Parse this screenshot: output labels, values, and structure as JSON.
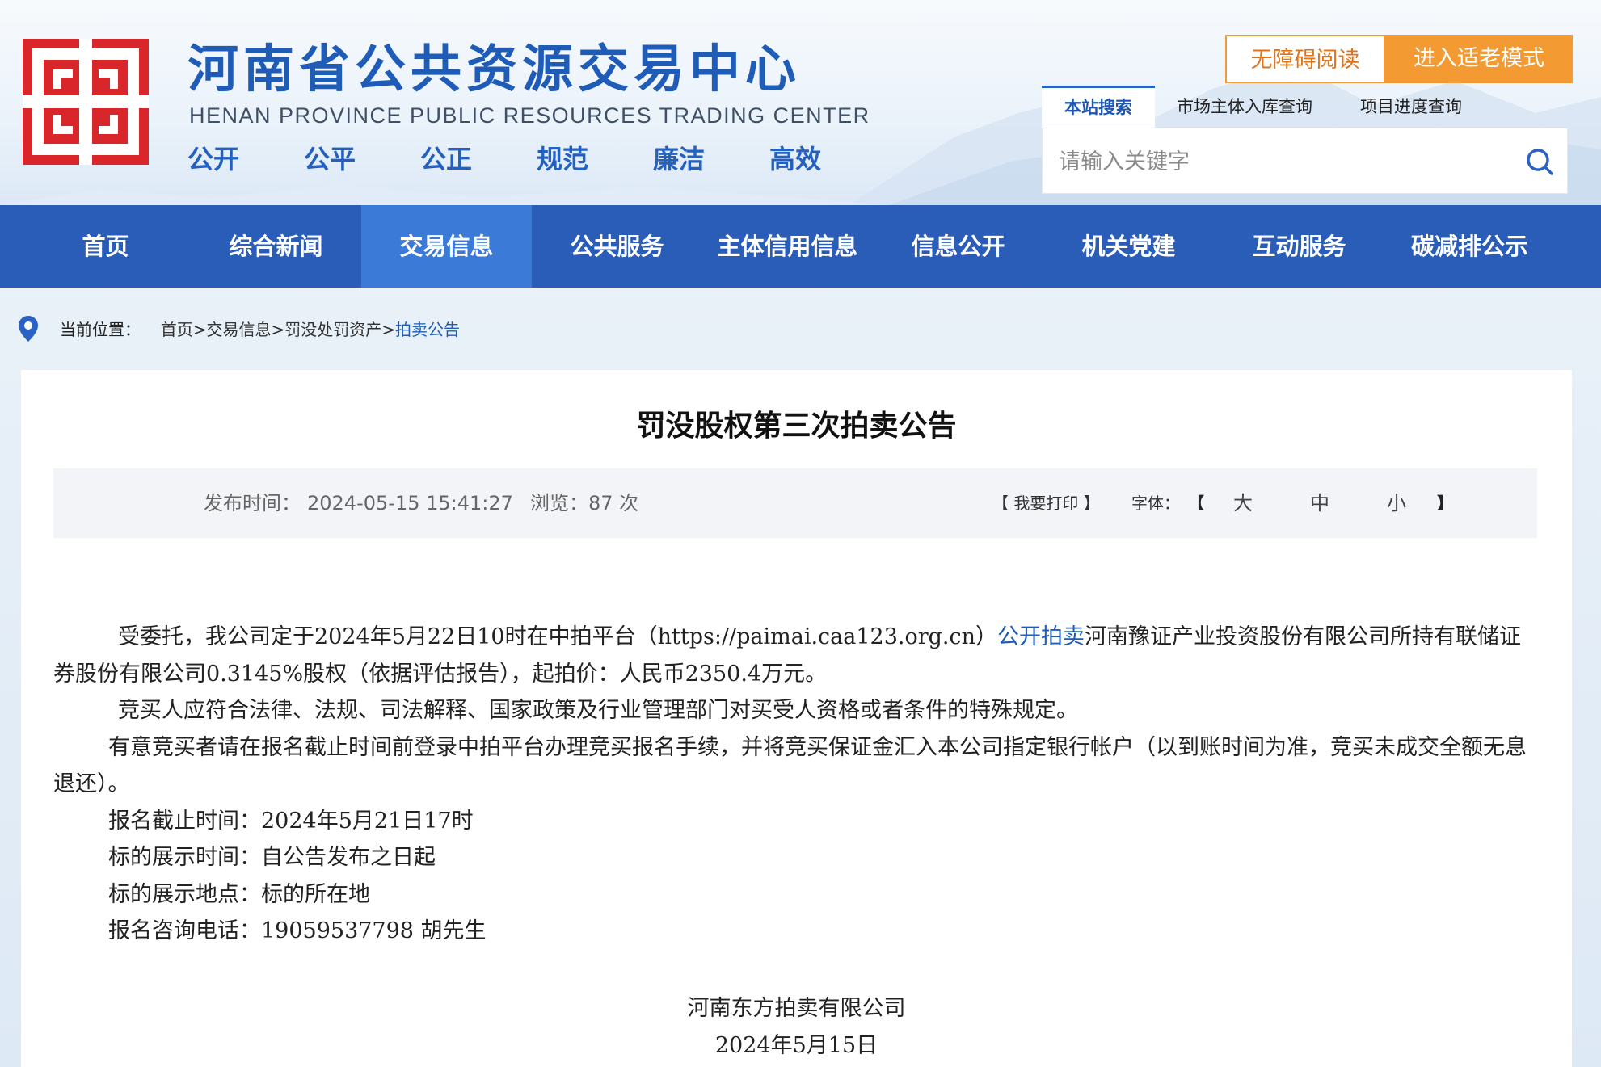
{
  "header": {
    "title": "河南省公共资源交易中心",
    "subtitle": "HENAN PROVINCE PUBLIC RESOURCES TRADING CENTER",
    "slogans": [
      "公开",
      "公平",
      "公正",
      "规范",
      "廉洁",
      "高效"
    ],
    "accessible_label": "无障碍阅读",
    "elder_mode_label": "进入适老模式",
    "search_tabs": [
      "本站搜索",
      "市场主体入库查询",
      "项目进度查询"
    ],
    "search_placeholder": "请输入关键字"
  },
  "nav": {
    "items": [
      "首页",
      "综合新闻",
      "交易信息",
      "公共服务",
      "主体信用信息",
      "信息公开",
      "机关党建",
      "互动服务",
      "碳减排公示"
    ],
    "active": "交易信息"
  },
  "breadcrumb": {
    "label": "当前位置：",
    "items": [
      "首页>",
      "交易信息>",
      "罚没处罚资产>"
    ],
    "current": "拍卖公告"
  },
  "article": {
    "title": "罚没股权第三次拍卖公告",
    "publish_label": "发布时间：",
    "publish_time": "2024-05-15 15:41:27",
    "views_text": "浏览：87 次",
    "print_label": "【 我要打印 】",
    "font_label": "字体：",
    "font_sizes": [
      "大",
      "中",
      "小"
    ],
    "bracket_open": "【",
    "bracket_close": "】",
    "p1_before": "受委托，我公司定于2024年5月22日10时在中拍平台（https://paimai.caa123.org.cn）",
    "p1_link": "公开拍卖",
    "p1_after": "河南豫证产业投资股份有限公司所持有联储证券股份有限公司0.3145%股权（依据评估报告），起拍价：人民币2350.4万元。",
    "p2": "竞买人应符合法律、法规、司法解释、国家政策及行业管理部门对买受人资格或者条件的特殊规定。",
    "p3": "有意竞买者请在报名截止时间前登录中拍平台办理竞买报名手续，并将竞买保证金汇入本公司指定银行帐户（以到账时间为准，竞买未成交全额无息退还）。",
    "lines": [
      "报名截止时间：2024年5月21日17时",
      "标的展示时间：自公告发布之日起",
      "标的展示地点：标的所在地",
      "报名咨询电话：19059537798  胡先生"
    ],
    "signature_company": "河南东方拍卖有限公司",
    "signature_date": "2024年5月15日"
  },
  "colors": {
    "brand_blue": "#2a5db8",
    "nav_active": "#3b7ad6",
    "title_blue": "#1f5cb8",
    "orange": "#f39a33",
    "logo_red": "#d8262b"
  },
  "icons": [
    "logo-seal-icon",
    "search-icon",
    "location-pin-icon"
  ]
}
